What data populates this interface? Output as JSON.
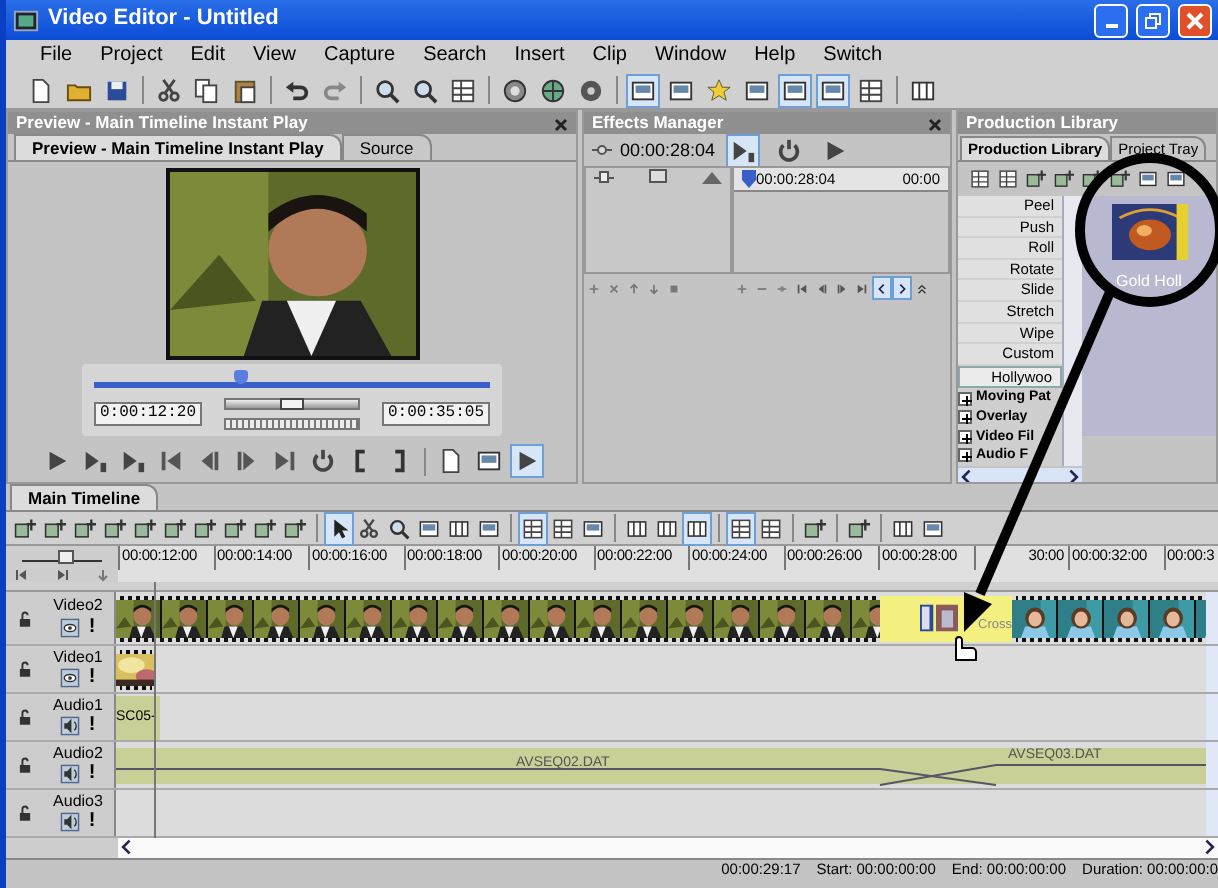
{
  "window": {
    "title": "Video Editor - Untitled"
  },
  "menu": [
    "File",
    "Project",
    "Edit",
    "View",
    "Capture",
    "Search",
    "Insert",
    "Clip",
    "Window",
    "Help",
    "Switch"
  ],
  "toolbar": [
    [
      {
        "kind": "page",
        "pressed": false
      },
      {
        "kind": "folder",
        "pressed": false
      },
      {
        "kind": "disk",
        "pressed": false
      }
    ],
    [
      {
        "kind": "scissors",
        "pressed": false
      },
      {
        "kind": "copy",
        "pressed": false
      },
      {
        "kind": "paste",
        "pressed": false
      }
    ],
    [
      {
        "kind": "undo",
        "pressed": false
      },
      {
        "kind": "redo",
        "pressed": false
      }
    ],
    [
      {
        "kind": "zoom",
        "pressed": false
      },
      {
        "kind": "zoom",
        "pressed": false
      },
      {
        "kind": "grid",
        "pressed": false
      }
    ],
    [
      {
        "kind": "gear",
        "pressed": false
      },
      {
        "kind": "globe",
        "pressed": false
      },
      {
        "kind": "disc",
        "pressed": false
      }
    ],
    [
      {
        "kind": "panel",
        "pressed": true
      },
      {
        "kind": "panel",
        "pressed": false
      },
      {
        "kind": "star",
        "pressed": false
      },
      {
        "kind": "panel",
        "pressed": false
      },
      {
        "kind": "panel",
        "pressed": true
      },
      {
        "kind": "panel",
        "pressed": true
      },
      {
        "kind": "grid",
        "pressed": false
      }
    ],
    [
      {
        "kind": "columns",
        "pressed": false
      }
    ]
  ],
  "preview": {
    "panel_title": "Preview - Main Timeline Instant Play",
    "tabs": [
      {
        "label": "Preview - Main Timeline Instant Play",
        "selected": true
      },
      {
        "label": "Source",
        "selected": false
      }
    ],
    "scrubber": {
      "level": 0.37
    },
    "shuttle": {
      "level": 0.5
    },
    "start_time": "0:00:12:20",
    "end_time": "0:00:35:05",
    "controls": [
      [
        {
          "kind": "play",
          "pressed": false
        },
        {
          "kind": "playmark",
          "pressed": false
        },
        {
          "kind": "playmark",
          "pressed": false
        },
        {
          "kind": "skipstart",
          "pressed": false
        },
        {
          "kind": "stepback",
          "pressed": false
        },
        {
          "kind": "stepfwd",
          "pressed": false
        },
        {
          "kind": "skipend",
          "pressed": false
        },
        {
          "kind": "loop",
          "pressed": false
        },
        {
          "kind": "bracketl",
          "pressed": false
        },
        {
          "kind": "bracketr",
          "pressed": false
        }
      ],
      [
        {
          "kind": "page",
          "pressed": false
        },
        {
          "kind": "panel",
          "pressed": false
        },
        {
          "kind": "play",
          "pressed": true
        }
      ]
    ]
  },
  "effects": {
    "panel_title": "Effects Manager",
    "time": "00:00:28:04",
    "buttons": [
      {
        "kind": "playmark",
        "pressed": true
      },
      {
        "kind": "loop",
        "pressed": false
      },
      {
        "kind": "play",
        "pressed": false
      }
    ],
    "ruler_start": "00:00:28:04",
    "ruler_end": "00:00",
    "left_tools": [
      {
        "kind": "plus",
        "pressed": false
      },
      {
        "kind": "cross",
        "pressed": false
      },
      {
        "kind": "up",
        "pressed": false
      },
      {
        "kind": "down",
        "pressed": false
      },
      {
        "kind": "stop",
        "pressed": false
      }
    ],
    "right_tools": [
      {
        "kind": "plus",
        "pressed": false
      },
      {
        "kind": "minus",
        "pressed": false
      },
      {
        "kind": "link",
        "pressed": false
      },
      {
        "kind": "skipstart",
        "pressed": false
      },
      {
        "kind": "stepback",
        "pressed": false
      },
      {
        "kind": "stepfwd",
        "pressed": false
      },
      {
        "kind": "skipend",
        "pressed": false
      },
      {
        "kind": "chevl",
        "pressed": true
      },
      {
        "kind": "chevr",
        "pressed": true
      },
      {
        "kind": "dblup",
        "pressed": false
      }
    ]
  },
  "library": {
    "panel_title": "Production Library",
    "tabs": [
      {
        "label": "Production Library",
        "selected": true
      },
      {
        "label": "Project Tray",
        "selected": false
      }
    ],
    "tools": [
      {
        "kind": "grid",
        "pressed": false
      },
      {
        "kind": "grid",
        "pressed": false
      },
      {
        "kind": "layer",
        "pressed": false
      },
      {
        "kind": "layer",
        "pressed": false
      },
      {
        "kind": "layer",
        "pressed": false
      },
      {
        "kind": "layer",
        "pressed": false
      },
      {
        "kind": "panel",
        "pressed": false
      },
      {
        "kind": "panel",
        "pressed": false
      }
    ],
    "items": [
      {
        "label": "Peel",
        "selected": false
      },
      {
        "label": "Push",
        "selected": false
      },
      {
        "label": "Roll",
        "selected": false
      },
      {
        "label": "Rotate",
        "selected": false
      },
      {
        "label": "Slide",
        "selected": false
      },
      {
        "label": "Stretch",
        "selected": false
      },
      {
        "label": "Wipe",
        "selected": false
      },
      {
        "label": "Custom",
        "selected": false
      },
      {
        "label": "Hollywoo",
        "selected": true
      }
    ],
    "folders": [
      {
        "label": "Moving Pat",
        "expanded": false
      },
      {
        "label": "Overlay",
        "expanded": false
      },
      {
        "label": "Video Fil",
        "expanded": false
      },
      {
        "label": "Audio F",
        "expanded": false
      }
    ],
    "thumbnail": {
      "caption": "Gold Holl"
    }
  },
  "timeline": {
    "tab": "Main Timeline",
    "zoom": {
      "level": 0.55
    },
    "tools": [
      [
        {
          "kind": "layer",
          "pressed": false
        },
        {
          "kind": "layer",
          "pressed": false
        },
        {
          "kind": "layer",
          "pressed": false
        },
        {
          "kind": "layer",
          "pressed": false
        },
        {
          "kind": "layer",
          "pressed": false
        },
        {
          "kind": "layer",
          "pressed": false
        },
        {
          "kind": "layer",
          "pressed": false
        },
        {
          "kind": "layer",
          "pressed": false
        },
        {
          "kind": "layer",
          "pressed": false
        },
        {
          "kind": "layer",
          "pressed": false
        }
      ],
      [
        {
          "kind": "pointer",
          "pressed": true
        },
        {
          "kind": "scissors",
          "pressed": false
        },
        {
          "kind": "zoom",
          "pressed": false
        },
        {
          "kind": "panel",
          "pressed": false
        },
        {
          "kind": "columns",
          "pressed": false
        },
        {
          "kind": "panel",
          "pressed": false
        }
      ],
      [
        {
          "kind": "grid",
          "pressed": true
        },
        {
          "kind": "grid",
          "pressed": false
        },
        {
          "kind": "panel",
          "pressed": false
        }
      ],
      [
        {
          "kind": "columns",
          "pressed": false
        },
        {
          "kind": "columns",
          "pressed": false
        },
        {
          "kind": "columns",
          "pressed": true
        }
      ],
      [
        {
          "kind": "grid",
          "pressed": true
        },
        {
          "kind": "grid",
          "pressed": false
        }
      ],
      [
        {
          "kind": "layer",
          "pressed": false
        }
      ],
      [
        {
          "kind": "layer",
          "pressed": false
        }
      ],
      [
        {
          "kind": "columns",
          "pressed": false
        },
        {
          "kind": "panel",
          "pressed": false
        }
      ]
    ],
    "ruler": [
      "00:00:12:00",
      "00:00:14:00",
      "00:00:16:00",
      "00:00:18:00",
      "00:00:20:00",
      "00:00:22:00",
      "00:00:24:00",
      "00:00:26:00",
      "00:00:28:00",
      "30:00",
      "00:00:32:00",
      "00:00:3"
    ],
    "tracks": [
      {
        "name": "Video2",
        "kind": "video",
        "flag": "!",
        "clips": [
          {
            "kind": "man"
          },
          {
            "kind": "transition",
            "label": "Cross"
          },
          {
            "kind": "girl"
          }
        ]
      },
      {
        "name": "Video1",
        "kind": "video",
        "flag": "!",
        "clips": [
          {
            "kind": "blur"
          }
        ]
      },
      {
        "name": "Audio1",
        "kind": "audio",
        "flag": "!",
        "clips": [
          {
            "kind": "audio",
            "label": "SC05-"
          }
        ]
      },
      {
        "name": "Audio2",
        "kind": "audio",
        "flag": "!",
        "clips": [
          {
            "kind": "crossfade",
            "label": "AVSEQ02.DAT",
            "label2": "AVSEQ03.DAT"
          }
        ]
      },
      {
        "name": "Audio3",
        "kind": "audio",
        "flag": "!"
      }
    ]
  },
  "status": [
    "00:00:29:17",
    "Start: 00:00:00:00",
    "End: 00:00:00:00",
    "Duration: 00:00:00:0"
  ]
}
